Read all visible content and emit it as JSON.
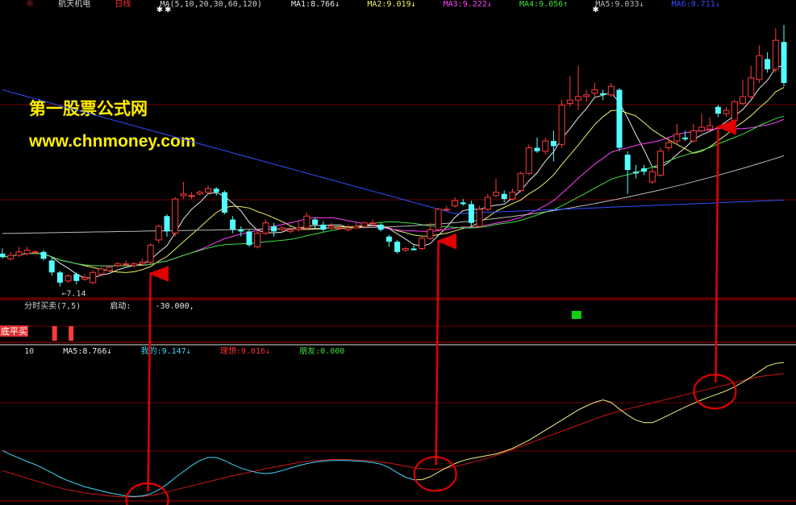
{
  "main_legend": {
    "name": "航天机电",
    "period": "日线",
    "ma_params": "MA(5,10,20,30,60,120)",
    "items": [
      {
        "label": "MA1:",
        "value": "8.766↓",
        "color": "#e8e8e8"
      },
      {
        "label": "MA2:",
        "value": "9.019↓",
        "color": "#f0f060"
      },
      {
        "label": "MA3:",
        "value": "9.222↓",
        "color": "#ff40ff"
      },
      {
        "label": "MA4:",
        "value": "9.056↑",
        "color": "#40e040"
      },
      {
        "label": "MA5:",
        "value": "9.033↓",
        "color": "#b8b8b8"
      },
      {
        "label": "MA6:",
        "value": "9.711↓",
        "color": "#3050ff"
      }
    ]
  },
  "watermark": {
    "line1": "第一股票公式网",
    "line2": "www.chnmoney.com"
  },
  "low_label": "←7.14",
  "sub1_legend": {
    "name": "分时买卖(7,5)",
    "label": "启动:",
    "value": "-30.000,"
  },
  "sub1_badge": "底平买",
  "sub2_legend": {
    "prefix": "10",
    "items": [
      {
        "label": "MA5:",
        "value": "8.766↓",
        "color": "#e8e8e8"
      },
      {
        "label": "我的:",
        "value": "9.147↓",
        "color": "#40d8ff"
      },
      {
        "label": "理想:",
        "value": "9.016↓",
        "color": "#ff3030"
      },
      {
        "label": "朋友:",
        "value": "0.000",
        "color": "#40e040"
      }
    ]
  },
  "colors": {
    "up": "#ff3a3a",
    "down": "#54ffff",
    "ma1": "#e8e8e8",
    "ma2": "#f0f060",
    "ma3": "#ff40ff",
    "ma4": "#40e040",
    "ma5": "#b8b8b8",
    "ma6": "#3050ff",
    "annotation": "#e00000"
  },
  "chart_data": {
    "type": "candlestick",
    "candles": [
      [
        8.1,
        8.0,
        8.25,
        7.95
      ],
      [
        7.95,
        8.05,
        8.15,
        7.9
      ],
      [
        8.05,
        8.15,
        8.3,
        8.0
      ],
      [
        8.1,
        8.2,
        8.3,
        8.05
      ],
      [
        8.15,
        8.15,
        8.2,
        8.1
      ],
      [
        8.15,
        7.95,
        8.2,
        7.9
      ],
      [
        7.9,
        7.55,
        8.0,
        7.45
      ],
      [
        7.55,
        7.25,
        7.6,
        7.14
      ],
      [
        7.3,
        7.45,
        7.5,
        7.25
      ],
      [
        7.5,
        7.3,
        7.55,
        7.2
      ],
      [
        7.35,
        7.4,
        7.5,
        7.3
      ],
      [
        7.25,
        7.55,
        7.6,
        7.2
      ],
      [
        7.5,
        7.65,
        7.7,
        7.45
      ],
      [
        7.6,
        7.7,
        7.75,
        7.55
      ],
      [
        7.75,
        7.8,
        7.85,
        7.7
      ],
      [
        7.8,
        7.8,
        7.9,
        7.75
      ],
      [
        7.75,
        7.8,
        7.85,
        7.7
      ],
      [
        7.8,
        7.85,
        7.95,
        7.75
      ],
      [
        7.85,
        8.35,
        8.4,
        7.8
      ],
      [
        8.5,
        8.9,
        8.95,
        8.4
      ],
      [
        9.2,
        8.75,
        9.25,
        8.6
      ],
      [
        8.7,
        9.7,
        9.75,
        8.6
      ],
      [
        9.8,
        9.85,
        10.2,
        9.7
      ],
      [
        9.8,
        9.8,
        9.9,
        9.7
      ],
      [
        9.85,
        9.9,
        9.95,
        9.8
      ],
      [
        9.9,
        10.0,
        10.1,
        9.85
      ],
      [
        10.0,
        9.9,
        10.05,
        9.8
      ],
      [
        9.9,
        9.3,
        9.95,
        9.25
      ],
      [
        9.1,
        8.8,
        9.2,
        8.7
      ],
      [
        8.8,
        8.75,
        8.9,
        8.6
      ],
      [
        8.75,
        8.35,
        8.8,
        8.3
      ],
      [
        8.3,
        8.7,
        8.8,
        8.25
      ],
      [
        8.7,
        9.0,
        9.1,
        8.65
      ],
      [
        8.9,
        8.75,
        9.0,
        8.6
      ],
      [
        8.8,
        8.85,
        8.9,
        8.75
      ],
      [
        8.75,
        8.8,
        8.9,
        8.7
      ],
      [
        8.8,
        8.85,
        9.05,
        8.75
      ],
      [
        8.85,
        9.2,
        9.3,
        8.8
      ],
      [
        9.1,
        8.95,
        9.15,
        8.85
      ],
      [
        8.95,
        8.8,
        9.05,
        8.75
      ],
      [
        8.85,
        8.9,
        9.0,
        8.8
      ],
      [
        8.85,
        8.85,
        8.9,
        8.8
      ],
      [
        8.8,
        8.85,
        8.95,
        8.75
      ],
      [
        8.85,
        8.9,
        9.0,
        8.85
      ],
      [
        8.9,
        9.0,
        9.05,
        8.85
      ],
      [
        9.0,
        9.0,
        9.1,
        8.95
      ],
      [
        8.95,
        8.8,
        9.0,
        8.75
      ],
      [
        8.6,
        8.45,
        8.65,
        8.3
      ],
      [
        8.45,
        8.15,
        8.5,
        8.1
      ],
      [
        8.2,
        8.25,
        8.3,
        8.15
      ],
      [
        8.25,
        8.2,
        8.35,
        8.2
      ],
      [
        8.25,
        8.55,
        8.6,
        8.2
      ],
      [
        8.55,
        8.8,
        9.0,
        8.5
      ],
      [
        8.8,
        9.4,
        9.45,
        8.75
      ],
      [
        9.4,
        9.4,
        9.5,
        9.35
      ],
      [
        9.5,
        9.65,
        9.75,
        9.45
      ],
      [
        9.6,
        9.55,
        9.7,
        9.5
      ],
      [
        9.55,
        9.0,
        9.65,
        8.9
      ],
      [
        8.9,
        9.4,
        9.5,
        8.85
      ],
      [
        9.4,
        9.75,
        9.85,
        9.35
      ],
      [
        9.8,
        9.9,
        10.3,
        9.75
      ],
      [
        9.85,
        9.7,
        9.95,
        9.6
      ],
      [
        9.7,
        9.9,
        10.0,
        9.65
      ],
      [
        9.95,
        10.45,
        10.5,
        9.9
      ],
      [
        10.45,
        11.2,
        11.3,
        10.4
      ],
      [
        11.2,
        11.1,
        11.5,
        11.05
      ],
      [
        11.1,
        11.4,
        11.5,
        11.0
      ],
      [
        11.4,
        11.25,
        11.7,
        10.8
      ],
      [
        11.3,
        12.45,
        12.6,
        11.2
      ],
      [
        12.5,
        12.6,
        13.3,
        12.4
      ],
      [
        12.6,
        12.7,
        13.6,
        12.3
      ],
      [
        12.7,
        12.75,
        12.9,
        12.55
      ],
      [
        12.8,
        12.9,
        13.1,
        12.7
      ],
      [
        12.8,
        12.75,
        12.9,
        12.6
      ],
      [
        12.75,
        13.0,
        13.1,
        12.7
      ],
      [
        12.9,
        11.2,
        12.95,
        11.1
      ],
      [
        11.0,
        10.55,
        11.1,
        9.85
      ],
      [
        10.5,
        10.45,
        10.7,
        10.3
      ],
      [
        10.6,
        10.5,
        10.7,
        10.4
      ],
      [
        10.2,
        10.5,
        10.6,
        10.15
      ],
      [
        10.4,
        11.1,
        11.2,
        10.35
      ],
      [
        11.2,
        11.35,
        11.5,
        11.1
      ],
      [
        11.4,
        11.6,
        11.9,
        11.3
      ],
      [
        11.5,
        11.45,
        11.7,
        11.4
      ],
      [
        11.4,
        11.7,
        11.9,
        11.35
      ],
      [
        11.7,
        11.8,
        12.2,
        11.65
      ],
      [
        11.75,
        11.85,
        12.1,
        11.7
      ],
      [
        12.4,
        12.2,
        12.45,
        12.1
      ],
      [
        12.2,
        12.3,
        12.4,
        12.1
      ],
      [
        12.0,
        12.55,
        12.6,
        11.9
      ],
      [
        12.5,
        12.7,
        13.2,
        12.45
      ],
      [
        12.7,
        13.25,
        13.6,
        12.65
      ],
      [
        13.2,
        13.9,
        14.2,
        13.1
      ],
      [
        13.8,
        13.5,
        14.0,
        13.4
      ],
      [
        13.5,
        14.35,
        14.7,
        13.4
      ],
      [
        14.3,
        13.1,
        14.8,
        13.0
      ]
    ],
    "low_marker": {
      "value": 7.14,
      "index": 7
    },
    "sub1_signals": [
      {
        "index": 6,
        "type": "底平买"
      },
      {
        "index": 8,
        "type": "底平买"
      }
    ],
    "sub1_marker": {
      "index": 69
    },
    "sub2_series_names": [
      "我的",
      "理想"
    ],
    "sub2_myline": [
      1.0,
      0.92,
      0.85,
      0.78,
      0.72,
      0.64,
      0.56,
      0.47,
      0.4,
      0.34,
      0.28,
      0.24,
      0.2,
      0.16,
      0.13,
      0.1,
      0.09,
      0.1,
      0.14,
      0.22,
      0.33,
      0.46,
      0.58,
      0.7,
      0.8,
      0.86,
      0.86,
      0.8,
      0.72,
      0.65,
      0.6,
      0.56,
      0.54,
      0.56,
      0.6,
      0.65,
      0.7,
      0.74,
      0.77,
      0.79,
      0.8,
      0.8,
      0.8,
      0.79,
      0.78,
      0.76,
      0.73,
      0.66,
      0.56,
      0.47,
      0.42,
      0.42,
      0.48,
      0.57,
      0.66,
      0.74,
      0.8,
      0.84,
      0.87,
      0.9,
      0.93,
      0.98,
      1.04,
      1.12,
      1.2,
      1.3,
      1.4,
      1.5,
      1.6,
      1.7,
      1.8,
      1.88,
      1.95,
      2.0,
      1.95,
      1.82,
      1.7,
      1.6,
      1.55,
      1.55,
      1.62,
      1.7,
      1.78,
      1.86,
      1.93,
      2.0,
      2.06,
      2.12,
      2.18,
      2.26,
      2.35,
      2.45,
      2.56,
      2.67,
      2.72,
      2.74
    ],
    "sub2_ideal": [
      0.6,
      0.55,
      0.5,
      0.45,
      0.4,
      0.35,
      0.3,
      0.26,
      0.22,
      0.19,
      0.16,
      0.14,
      0.12,
      0.1,
      0.09,
      0.08,
      0.08,
      0.09,
      0.11,
      0.14,
      0.18,
      0.22,
      0.26,
      0.3,
      0.34,
      0.38,
      0.42,
      0.46,
      0.5,
      0.53,
      0.57,
      0.6,
      0.64,
      0.67,
      0.7,
      0.73,
      0.76,
      0.78,
      0.8,
      0.81,
      0.82,
      0.82,
      0.82,
      0.81,
      0.8,
      0.79,
      0.77,
      0.75,
      0.72,
      0.69,
      0.66,
      0.64,
      0.63,
      0.63,
      0.65,
      0.68,
      0.72,
      0.76,
      0.8,
      0.85,
      0.9,
      0.96,
      1.02,
      1.08,
      1.14,
      1.2,
      1.26,
      1.32,
      1.38,
      1.44,
      1.5,
      1.56,
      1.62,
      1.68,
      1.73,
      1.78,
      1.82,
      1.86,
      1.9,
      1.94,
      1.98,
      2.02,
      2.06,
      2.1,
      2.14,
      2.18,
      2.22,
      2.26,
      2.3,
      2.34,
      2.38,
      2.42,
      2.46,
      2.48,
      2.5,
      2.52
    ],
    "sub2_cyan_end_index": 50,
    "buy_points": [
      {
        "index": 18
      },
      {
        "index": 53
      },
      {
        "index": 87
      }
    ],
    "top_markers": [
      {
        "index": 19
      },
      {
        "index": 20
      },
      {
        "index": 72
      },
      {
        "index": 97
      }
    ]
  }
}
